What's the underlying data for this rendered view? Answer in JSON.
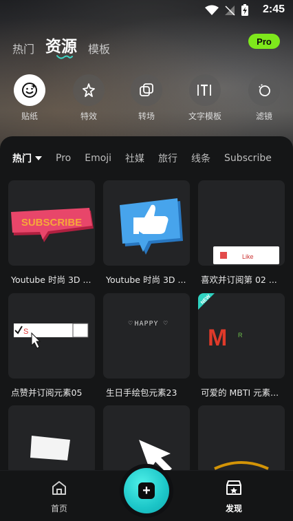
{
  "status": {
    "time": "2:45"
  },
  "top_tabs": [
    {
      "label": "热门"
    },
    {
      "label": "资源"
    },
    {
      "label": "模板"
    }
  ],
  "pro_badge": "Pro",
  "categories": [
    {
      "label": "贴纸",
      "icon": "sticker-icon"
    },
    {
      "label": "特效",
      "icon": "effects-icon"
    },
    {
      "label": "转场",
      "icon": "transition-icon"
    },
    {
      "label": "文字模板",
      "icon": "text-template-icon"
    },
    {
      "label": "滤镜",
      "icon": "filter-icon"
    }
  ],
  "filters": [
    "热门",
    "Pro",
    "Emoji",
    "社媒",
    "旅行",
    "线条",
    "Subscribe"
  ],
  "cards": [
    {
      "title": "Youtube 时尚 3D ...",
      "preview_text": "SUBSCRIBE"
    },
    {
      "title": "Youtube 时尚 3D ...",
      "preview_text": ""
    },
    {
      "title": "喜欢并订阅第 02 ...",
      "preview_text": "Like"
    },
    {
      "title": "点赞并订阅元素05",
      "preview_text": "S"
    },
    {
      "title": "生日手绘包元素23",
      "preview_text": "HAPPY"
    },
    {
      "title": "可爱的 MBTI 元素...",
      "preview_text": "M",
      "badge": "NEW"
    },
    {
      "title": "",
      "preview_text": ""
    },
    {
      "title": "",
      "preview_text": ""
    },
    {
      "title": "",
      "preview_text": ""
    }
  ],
  "bottom_nav": {
    "home_label": "首页",
    "discover_label": "发现",
    "fab_symbol": "+"
  }
}
